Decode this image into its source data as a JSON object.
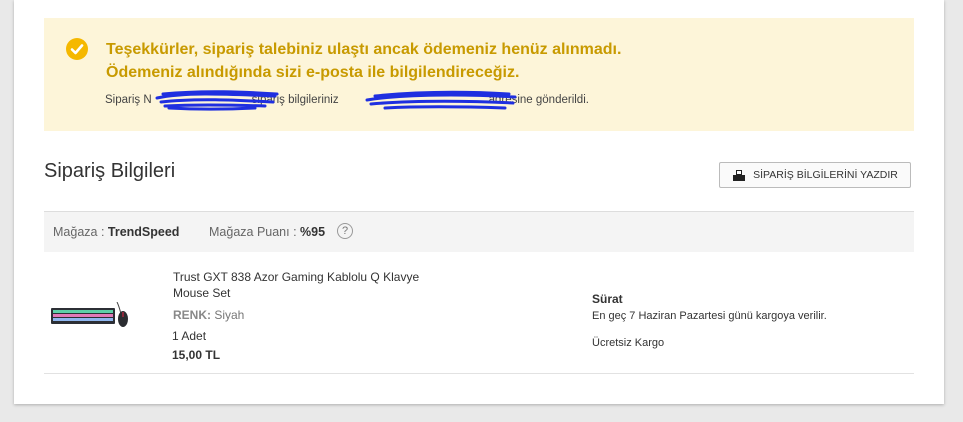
{
  "notice": {
    "title_line1": "Teşekkürler, sipariş talebiniz ulaştı ancak ödemeniz henüz alınmadı.",
    "title_line2": "Ödemeniz alındığında sizi e-posta ile bilgilendireceğiz.",
    "sub_prefix": "Sipariş N",
    "sub_middle": "sipariş bilgileriniz",
    "sub_suffix": "adresine gönderildi.",
    "icon": "check-circle-icon"
  },
  "section": {
    "title": "Sipariş Bilgileri",
    "print_label": "SİPARİŞ BİLGİLERİNİ YAZDIR"
  },
  "store": {
    "name_label": "Mağaza : ",
    "name_value": "TrendSpeed",
    "score_label": "Mağaza Puanı : ",
    "score_value": "%95",
    "help": "?"
  },
  "product": {
    "name": "Trust GXT 838 Azor Gaming Kablolu Q Klavye Mouse Set",
    "color_label": "RENK:",
    "color_value": " Siyah",
    "quantity": "1 Adet",
    "price": "15,00 TL"
  },
  "shipping": {
    "title": "Sürat",
    "date": "En geç 7 Haziran Pazartesi günü kargoya verilir.",
    "cost": "Ücretsiz Kargo"
  },
  "colors": {
    "notice_bg": "#fdf5d9",
    "notice_text": "#c89a00",
    "check": "#f5b800",
    "scribble": "#1f2fe0"
  }
}
